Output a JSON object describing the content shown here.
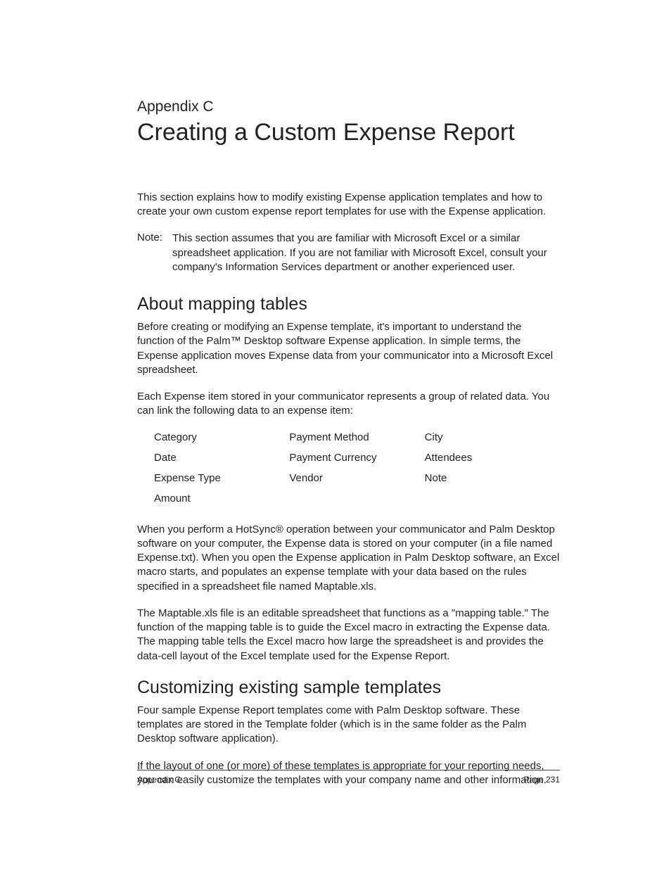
{
  "header": {
    "appendix": "Appendix C",
    "title": "Creating a Custom Expense Report"
  },
  "intro": "This section explains how to modify existing Expense application templates and how to create your own custom expense report templates for use with the Expense application.",
  "note": {
    "label": "Note:",
    "body": "This section assumes that you are familiar with Microsoft Excel or a similar spreadsheet application. If you are not familiar with Microsoft Excel, consult your company's Information Services department or another experienced user."
  },
  "section1": {
    "heading": "About mapping tables",
    "para1": "Before creating or modifying an Expense template, it's important to understand the function of the Palm™ Desktop software Expense application. In simple terms, the Expense application moves Expense data from your communicator into a Microsoft Excel spreadsheet.",
    "para2": "Each Expense item stored in your communicator represents a group of related data. You can link the following data to an expense item:",
    "table": {
      "col1": [
        "Category",
        "Date",
        "Expense Type",
        "Amount"
      ],
      "col2": [
        "Payment Method",
        "Payment Currency",
        "Vendor"
      ],
      "col3": [
        "City",
        "Attendees",
        "Note"
      ]
    },
    "para3": "When you perform a HotSync® operation between your communicator and Palm Desktop software on your computer, the Expense data is stored on your computer (in a file named Expense.txt). When you open the Expense application in Palm Desktop software, an Excel macro starts, and populates an expense template with your data based on the rules specified in a spreadsheet file named Maptable.xls.",
    "para4": "The Maptable.xls file is an editable spreadsheet that functions as a \"mapping table.\" The function of the mapping table is to guide the Excel macro in extracting the Expense data. The mapping table tells the Excel macro how large the spreadsheet is and provides the data-cell layout of the Excel template used for the Expense Report."
  },
  "section2": {
    "heading": "Customizing existing sample templates",
    "para1": "Four sample Expense Report templates come with Palm Desktop software. These templates are stored in the Template folder (which is in the same folder as the Palm Desktop software application).",
    "para2": "If the layout of one (or more) of these templates is appropriate for your reporting needs, you can easily customize the templates with your company name and other information."
  },
  "footer": {
    "left": "Appendix C",
    "right": "Page 231"
  }
}
